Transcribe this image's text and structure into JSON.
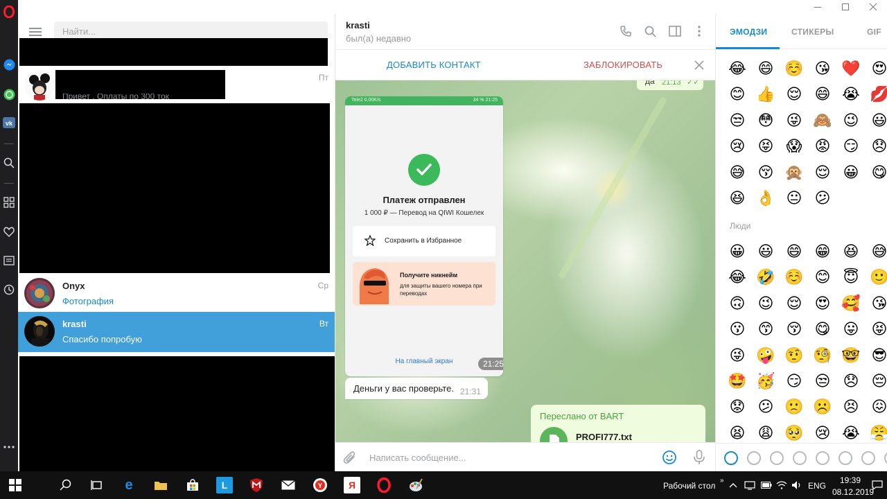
{
  "sidebar_icons": [
    "opera-logo-icon",
    "messenger-icon",
    "whatsapp-icon",
    "vk-icon",
    "search-icon",
    "grid-icon",
    "heart-icon",
    "news-icon",
    "history-icon",
    "more-icon"
  ],
  "left": {
    "search_placeholder": "Найти...",
    "chats": [
      {
        "name": "",
        "time": "Пт",
        "preview": "Привет . Оплаты по 300 ток"
      },
      {
        "name": "Onyx",
        "time": "Ср",
        "preview": "Фотография"
      },
      {
        "name": "krasti",
        "time": "Вт",
        "preview": "Спасибо попробую"
      }
    ]
  },
  "chat": {
    "peer_name": "krasti",
    "peer_status": "был(а) недавно",
    "add_contact": "ДОБАВИТЬ КОНТАКТ",
    "block": "ЗАБЛОКИРОВАТЬ",
    "top_msg": {
      "text": "да",
      "time": "21:13"
    },
    "payment": {
      "carrier": "Tele2  0,00K/s",
      "status_right": "34 %  21:25",
      "title": "Платеж отправлен",
      "subtitle": "1 000 ₽ — Перевод на QIWI Кошелек",
      "favorite": "Сохранить в Избранное",
      "promo_title": "Получите никнейм",
      "promo_sub": "для защиты вашего номера при переводах",
      "home": "На главный экран",
      "time": "21:25"
    },
    "incoming": {
      "text": "Деньги у вас проверьте.",
      "time": "21:31"
    },
    "forward": {
      "label": "Переслано от BART",
      "file": "PROFI777.txt"
    },
    "composer_placeholder": "Написать сообщение..."
  },
  "emoji_panel": {
    "tabs": [
      "ЭМОДЗИ",
      "СТИКЕРЫ",
      "GIF"
    ],
    "active_tab": "ЭМОДЗИ",
    "people_label": "Люди",
    "recent": [
      [
        "😂",
        "😄",
        "☺️",
        "😘",
        "❤️",
        "😍"
      ],
      [
        "😊",
        "👍",
        "😌",
        "😄",
        "😭",
        "💋"
      ],
      [
        "😒",
        "😳",
        "😜",
        "🙈",
        "😉",
        "😃"
      ],
      [
        "😢",
        "😝",
        "😱",
        "😡",
        "😏",
        "😞"
      ],
      [
        "😅",
        "😚",
        "🙊",
        "😌",
        "😀",
        "😋"
      ],
      [
        "😆",
        "👌",
        "😐",
        "😕"
      ]
    ],
    "people": [
      [
        "😀",
        "😃",
        "😄",
        "😁",
        "😆",
        "😅"
      ],
      [
        "😂",
        "🤣",
        "☺️",
        "😊",
        "😇",
        "🙂"
      ],
      [
        "🙃",
        "😉",
        "😌",
        "😍",
        "🥰",
        "😘"
      ],
      [
        "😗",
        "😙",
        "😚",
        "😋",
        "😛",
        "😝"
      ],
      [
        "😜",
        "🤪",
        "🤨",
        "🧐",
        "🤓",
        "😎"
      ],
      [
        "🤩",
        "🥳",
        "😏",
        "😒",
        "😞",
        "😔"
      ],
      [
        "😟",
        "😕",
        "🙁",
        "☹️",
        "😣",
        "😖"
      ],
      [
        "😫",
        "😩",
        "🥺",
        "😢",
        "😭",
        "😤"
      ]
    ],
    "categories": [
      "recent-icon",
      "smile-icon",
      "animal-icon",
      "food-icon",
      "sport-icon",
      "car-icon",
      "bulb-icon",
      "symbols-icon"
    ]
  },
  "taskbar": {
    "desktop_label": "Рабочий стол",
    "lang": "ENG",
    "time": "19:39",
    "date": "08.12.2019",
    "apps": [
      "windows-start-icon",
      "search-icon",
      "task-view-icon",
      "edge-icon",
      "explorer-icon",
      "store-icon",
      "l-app-icon",
      "mcafee-icon",
      "mail-icon",
      "yandex-browser-icon",
      "yandex-icon",
      "opera-icon",
      "paint-icon"
    ]
  },
  "colors": {
    "accent": "#168acd",
    "active_row": "#419fd9",
    "block_red": "#d14e4e",
    "out_bubble": "#effdde",
    "qiwi_green": "#3cb95a"
  }
}
